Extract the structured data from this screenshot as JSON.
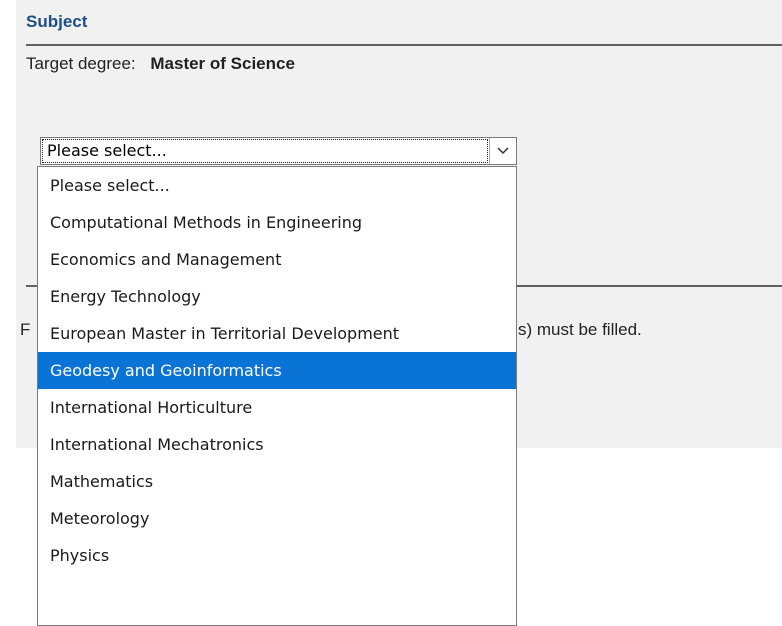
{
  "section": {
    "title": "Subject"
  },
  "degree": {
    "label": "Target degree:",
    "value": "Master of Science"
  },
  "select": {
    "current_value": "Please select...",
    "arrow_icon": "chevron-down-icon",
    "highlighted_index": 5,
    "options": [
      "Please select...",
      "Computational Methods in Engineering",
      "Economics and Management",
      "Energy Technology",
      "European Master in Territorial Development",
      "Geodesy and Geoinformatics",
      "International Horticulture",
      "International Mechatronics",
      "Mathematics",
      "Meteorology",
      "Physics"
    ]
  },
  "note": {
    "left_fragment": "F",
    "right_fragment": "s) must be filled."
  },
  "colors": {
    "title": "#1d4e86",
    "highlight": "#0a74d6",
    "panel_background": "#f1f1f1"
  }
}
